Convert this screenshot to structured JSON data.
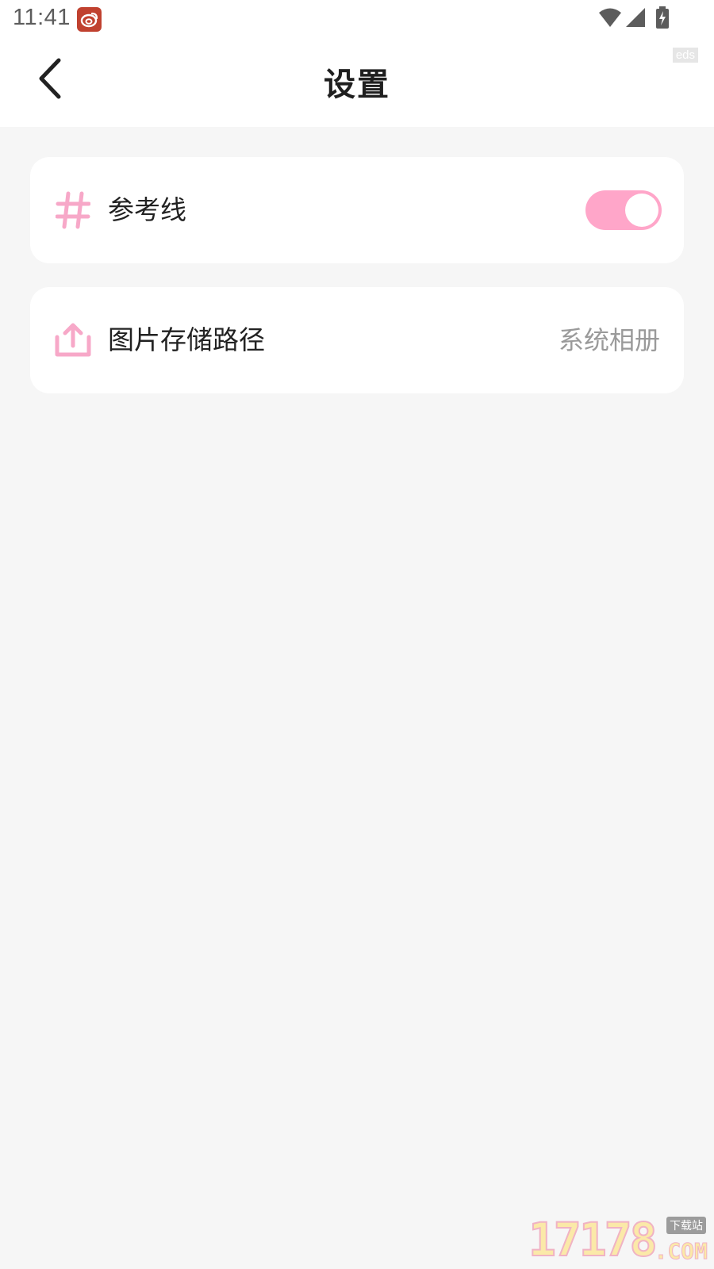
{
  "status_bar": {
    "time": "11:41",
    "app_icon": "weibo-icon",
    "icons": [
      "wifi-icon",
      "cell-signal-icon",
      "battery-charging-icon"
    ]
  },
  "header": {
    "title": "设置",
    "back_icon": "chevron-left-icon",
    "debug_tag": "eds"
  },
  "settings": {
    "items": [
      {
        "icon": "grid-icon",
        "label": "参考线",
        "control": "toggle",
        "enabled": true
      },
      {
        "icon": "upload-icon",
        "label": "图片存储路径",
        "value": "系统相册"
      }
    ]
  },
  "colors": {
    "accent": "#ffa6c9",
    "icon_pink": "#f7a8c8",
    "page_background": "#f6f6f6",
    "card_background": "#ffffff"
  },
  "watermark": {
    "digits": "17178",
    "tag": "下载站",
    "suffix": ".COM"
  }
}
